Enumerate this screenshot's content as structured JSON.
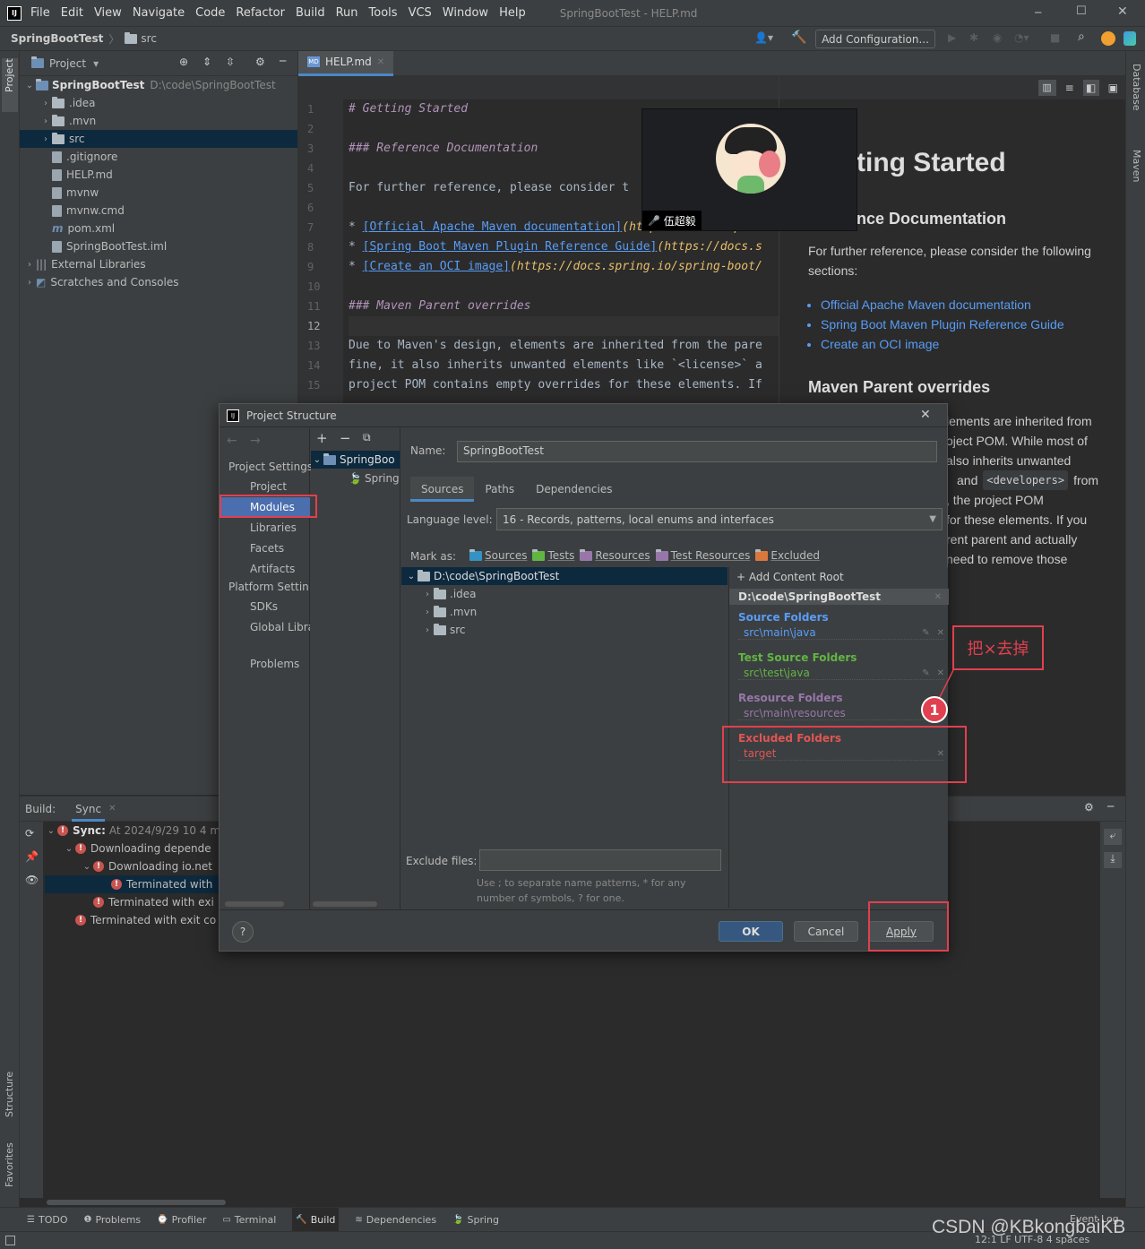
{
  "menu": {
    "items": [
      "File",
      "Edit",
      "View",
      "Navigate",
      "Code",
      "Refactor",
      "Build",
      "Run",
      "Tools",
      "VCS",
      "Window",
      "Help"
    ],
    "title": "SpringBootTest - HELP.md"
  },
  "nav": {
    "project": "SpringBootTest",
    "folder": "src",
    "add_config": "Add Configuration..."
  },
  "project_panel": {
    "title": "Project",
    "root": "SpringBootTest",
    "root_path": "D:\\code\\SpringBootTest",
    "items": [
      ".idea",
      ".mvn",
      "src",
      ".gitignore",
      "HELP.md",
      "mvnw",
      "mvnw.cmd",
      "pom.xml",
      "SpringBootTest.iml",
      "External Libraries",
      "Scratches and Consoles"
    ]
  },
  "side_tabs": {
    "project": "Project",
    "structure": "Structure",
    "favorites": "Favorites",
    "database": "Database",
    "maven": "Maven"
  },
  "editor": {
    "tab": "HELP.md",
    "lines": [
      "1",
      "2",
      "3",
      "4",
      "5",
      "6",
      "7",
      "8",
      "9",
      "10",
      "11",
      "12",
      "13",
      "14",
      "15"
    ],
    "code": [
      "# Getting Started",
      "",
      "### Reference Documentation",
      "",
      "For further reference, please consider t",
      "",
      "* [Official Apache Maven documentation](https://maven.apach",
      "* [Spring Boot Maven Plugin Reference Guide](https://docs.s",
      "* [Create an OCI image](https://docs.spring.io/spring-boot/",
      "",
      "### Maven Parent overrides",
      "",
      "Due to Maven's design, elements are inherited from the pare",
      "fine, it also inherits unwanted elements like `<license>` a",
      "project POM contains empty overrides for these elements. If"
    ]
  },
  "preview": {
    "h1": "ting Started",
    "h2": "nce Documentation",
    "para": "For further reference, please consider the following sections:",
    "links": [
      "Official Apache Maven documentation",
      "Spring Boot Maven Plugin Reference Guide",
      "Create an OCI image"
    ],
    "h2b": "Maven Parent overrides",
    "p2": [
      "lements are inherited from",
      "oject POM. While most of",
      "also inherits unwanted",
      "and",
      "<developers>",
      "from",
      ", the project POM",
      "for these elements. If you",
      "rent parent and actually",
      "need to remove those"
    ]
  },
  "overlay": {
    "name": "伍超毅"
  },
  "build": {
    "title": "Build:",
    "tab": "Sync",
    "items": [
      {
        "text": "Sync:",
        "sub": "At 2024/9/29 10 4 m",
        "indent": 0
      },
      {
        "text": "Downloading depende",
        "indent": 1
      },
      {
        "text": "Downloading io.net",
        "indent": 2
      },
      {
        "text": "Terminated with",
        "indent": 3
      },
      {
        "text": "Terminated with exi",
        "indent": 2
      },
      {
        "text": "Terminated with exit co",
        "indent": 1
      }
    ]
  },
  "dialog": {
    "title": "Project Structure",
    "section1": "Project Settings",
    "section2": "Platform Setting",
    "nav": [
      "Project",
      "Modules",
      "Libraries",
      "Facets",
      "Artifacts"
    ],
    "nav2": [
      "SDKs",
      "Global Libra"
    ],
    "problems": "Problems",
    "module_tree": [
      "SpringBoo",
      "Spring"
    ],
    "name_label": "Name:",
    "name_value": "SpringBootTest",
    "tabs": [
      "Sources",
      "Paths",
      "Dependencies"
    ],
    "lang_label": "Language level:",
    "lang_value": "16 - Records, patterns, local enums and interfaces",
    "mark_label": "Mark as:",
    "marks": [
      "Sources",
      "Tests",
      "Resources",
      "Test Resources",
      "Excluded"
    ],
    "tree_root": "D:\\code\\SpringBootTest",
    "tree_items": [
      ".idea",
      ".mvn",
      "src"
    ],
    "add_root": "+ Add Content Root",
    "root_header": "D:\\code\\SpringBootTest",
    "source_title": "Source Folders",
    "source_path": "src\\main\\java",
    "test_title": "Test Source Folders",
    "test_path": "src\\test\\java",
    "resource_title": "Resource Folders",
    "resource_path": "src\\main\\resources",
    "excluded_title": "Excluded Folders",
    "excluded_path": "target",
    "exclude_label": "Exclude files:",
    "hint": "Use ; to separate name patterns, * for any number of symbols, ? for one.",
    "ok": "OK",
    "cancel": "Cancel",
    "apply": "Apply",
    "help": "?"
  },
  "annotation": {
    "text": "把×去掉",
    "badge": "1"
  },
  "statusbar": {
    "tabs": [
      "TODO",
      "Problems",
      "Profiler",
      "Terminal",
      "Build",
      "Dependencies",
      "Spring"
    ],
    "event_log": "Event Log",
    "right": "12:1  LF  UTF-8  4 spaces"
  },
  "watermark": "CSDN @KBkongbaiKB",
  "colors": {
    "accent": "#4b6eaf",
    "source": "#589df6",
    "test": "#62b543",
    "resource": "#9876aa",
    "excluded": "#e05555",
    "red": "#e0404f"
  }
}
